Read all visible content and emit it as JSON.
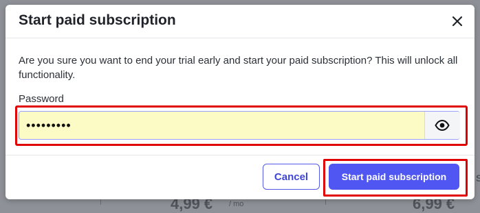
{
  "dialog": {
    "title": "Start paid subscription",
    "message": "Are you sure you want to end your trial early and start your paid subscription? This will unlock all functionality.",
    "password_label": "Password",
    "password_value": "•••••••••",
    "cancel_label": "Cancel",
    "confirm_label": "Start paid subscription"
  },
  "background": {
    "price_left": "4,99 €",
    "unit_left": "/ mo",
    "price_right": "6,99 €",
    "side_letter": "S"
  },
  "icons": {
    "close": "close-icon",
    "reveal": "eye-icon"
  },
  "colors": {
    "accent": "#4f56f2",
    "highlight": "#e00000",
    "input_fill": "#fdfbc5"
  }
}
